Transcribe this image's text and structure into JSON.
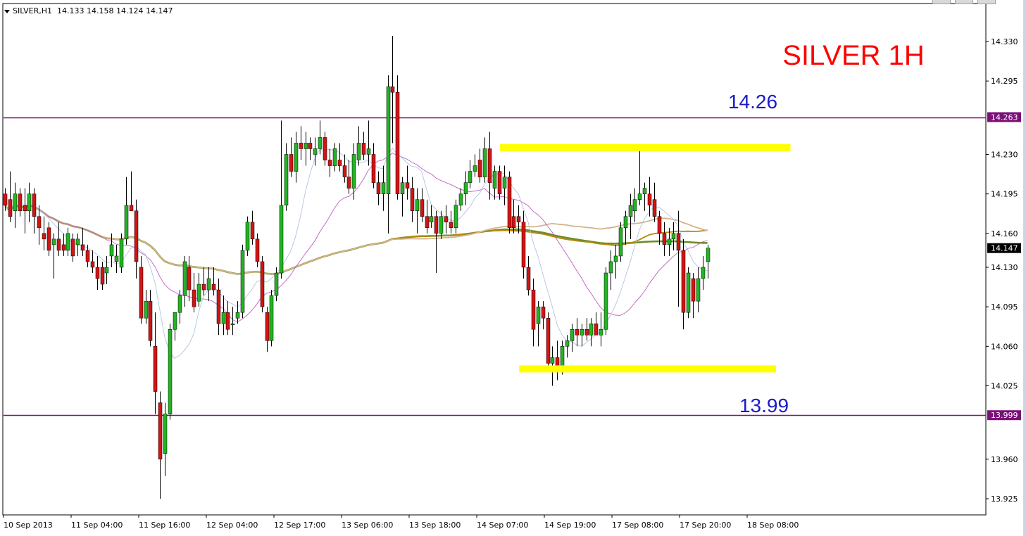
{
  "header": {
    "symbol": "SILVER,H1",
    "ohlc": "14.133 14.158 14.124 14.147"
  },
  "annotations": {
    "title": "SILVER 1H",
    "resistance_label": "14.26",
    "support_label": "13.99"
  },
  "price_axis": {
    "ticks": [
      "14.330",
      "14.295",
      "14.230",
      "14.195",
      "14.160",
      "14.130",
      "14.095",
      "14.060",
      "14.025",
      "13.960",
      "13.925"
    ],
    "hidden_ticks": [
      "14.263",
      "13.999"
    ],
    "badges": [
      {
        "value": "14.263",
        "color": "#7a0f78"
      },
      {
        "value": "14.147",
        "color": "#000000"
      },
      {
        "value": "13.999",
        "color": "#7a0f78"
      }
    ]
  },
  "time_axis": {
    "labels": [
      "10 Sep 2013",
      "11 Sep 04:00",
      "11 Sep 16:00",
      "12 Sep 04:00",
      "12 Sep 17:00",
      "13 Sep 06:00",
      "13 Sep 18:00",
      "14 Sep 07:00",
      "14 Sep 19:00",
      "17 Sep 08:00",
      "17 Sep 20:00",
      "18 Sep 08:00"
    ]
  },
  "colors": {
    "background": "#ffffff",
    "bull": "#22b422",
    "bear": "#d21414",
    "wick": "#000000",
    "hline": "#7a0f78",
    "zone": "#ffff00",
    "title": "#ff0000",
    "level_label": "#1a1acc",
    "ma_long": "#6b8e23",
    "ma_mid": "#b8860b",
    "ma_mid2": "#d2b48c",
    "ma_short": "#b0c4de",
    "ma_fast": "#c060c0"
  },
  "chart_data": {
    "type": "candlestick",
    "title": "SILVER 1H",
    "ylim": [
      13.905,
      14.345
    ],
    "horizontal_lines": [
      14.263,
      13.999
    ],
    "zones": [
      {
        "price": 14.236,
        "from": 102,
        "to": 162
      },
      {
        "price": 14.04,
        "from": 106,
        "to": 159
      }
    ],
    "candles": [
      [
        14.195,
        14.2,
        14.18,
        14.185
      ],
      [
        14.19,
        14.215,
        14.17,
        14.175
      ],
      [
        14.18,
        14.205,
        14.165,
        14.195
      ],
      [
        14.195,
        14.2,
        14.175,
        14.18
      ],
      [
        14.185,
        14.2,
        14.16,
        14.18
      ],
      [
        14.18,
        14.205,
        14.17,
        14.195
      ],
      [
        14.195,
        14.2,
        14.16,
        14.175
      ],
      [
        14.175,
        14.185,
        14.15,
        14.165
      ],
      [
        14.16,
        14.175,
        14.145,
        14.155
      ],
      [
        14.165,
        14.17,
        14.14,
        14.145
      ],
      [
        14.15,
        14.16,
        14.12,
        14.155
      ],
      [
        14.155,
        14.17,
        14.14,
        14.145
      ],
      [
        14.15,
        14.16,
        14.14,
        14.145
      ],
      [
        14.145,
        14.165,
        14.14,
        14.16
      ],
      [
        14.155,
        14.16,
        14.135,
        14.14
      ],
      [
        14.15,
        14.16,
        14.14,
        14.155
      ],
      [
        14.15,
        14.165,
        14.14,
        14.145
      ],
      [
        14.145,
        14.15,
        14.13,
        14.135
      ],
      [
        14.135,
        14.145,
        14.125,
        14.13
      ],
      [
        14.13,
        14.14,
        14.11,
        14.12
      ],
      [
        14.13,
        14.135,
        14.11,
        14.115
      ],
      [
        14.125,
        14.14,
        14.115,
        14.13
      ],
      [
        14.14,
        14.16,
        14.13,
        14.15
      ],
      [
        14.135,
        14.15,
        14.125,
        14.14
      ],
      [
        14.13,
        14.16,
        14.125,
        14.155
      ],
      [
        14.155,
        14.21,
        14.15,
        14.185
      ],
      [
        14.185,
        14.215,
        14.18,
        14.18
      ],
      [
        14.18,
        14.19,
        14.12,
        14.135
      ],
      [
        14.13,
        14.14,
        14.08,
        14.085
      ],
      [
        14.085,
        14.11,
        14.08,
        14.1
      ],
      [
        14.1,
        14.11,
        14.06,
        14.065
      ],
      [
        14.06,
        14.09,
        14.0,
        14.02
      ],
      [
        14.01,
        14.02,
        13.925,
        13.96
      ],
      [
        13.965,
        14.01,
        13.945,
        14.0
      ],
      [
        14.0,
        14.08,
        13.995,
        14.075
      ],
      [
        14.075,
        14.09,
        14.065,
        14.09
      ],
      [
        14.09,
        14.11,
        14.08,
        14.105
      ],
      [
        14.105,
        14.14,
        14.095,
        14.135
      ],
      [
        14.13,
        14.14,
        14.1,
        14.11
      ],
      [
        14.11,
        14.125,
        14.09,
        14.095
      ],
      [
        14.1,
        14.125,
        14.095,
        14.115
      ],
      [
        14.115,
        14.13,
        14.105,
        14.11
      ],
      [
        14.11,
        14.13,
        14.1,
        14.12
      ],
      [
        14.115,
        14.13,
        14.105,
        14.11
      ],
      [
        14.11,
        14.12,
        14.07,
        14.08
      ],
      [
        14.08,
        14.105,
        14.07,
        14.09
      ],
      [
        14.09,
        14.1,
        14.07,
        14.075
      ],
      [
        14.08,
        14.095,
        14.07,
        14.08
      ],
      [
        14.085,
        14.1,
        14.08,
        14.09
      ],
      [
        14.09,
        14.15,
        14.085,
        14.145
      ],
      [
        14.145,
        14.175,
        14.14,
        14.17
      ],
      [
        14.17,
        14.18,
        14.15,
        14.155
      ],
      [
        14.155,
        14.16,
        14.13,
        14.135
      ],
      [
        14.135,
        14.14,
        14.09,
        14.095
      ],
      [
        14.09,
        14.095,
        14.055,
        14.065
      ],
      [
        14.065,
        14.11,
        14.06,
        14.105
      ],
      [
        14.105,
        14.13,
        14.1,
        14.125
      ],
      [
        14.125,
        14.26,
        14.12,
        14.185
      ],
      [
        14.185,
        14.24,
        14.18,
        14.23
      ],
      [
        14.23,
        14.245,
        14.21,
        14.215
      ],
      [
        14.215,
        14.25,
        14.205,
        14.24
      ],
      [
        14.24,
        14.255,
        14.225,
        14.235
      ],
      [
        14.235,
        14.25,
        14.22,
        14.24
      ],
      [
        14.24,
        14.245,
        14.225,
        14.235
      ],
      [
        14.23,
        14.245,
        14.22,
        14.235
      ],
      [
        14.235,
        14.26,
        14.23,
        14.245
      ],
      [
        14.245,
        14.25,
        14.22,
        14.225
      ],
      [
        14.225,
        14.235,
        14.21,
        14.22
      ],
      [
        14.22,
        14.24,
        14.215,
        14.235
      ],
      [
        14.225,
        14.24,
        14.215,
        14.22
      ],
      [
        14.22,
        14.23,
        14.205,
        14.21
      ],
      [
        14.21,
        14.225,
        14.195,
        14.2
      ],
      [
        14.2,
        14.24,
        14.19,
        14.23
      ],
      [
        14.225,
        14.255,
        14.22,
        14.24
      ],
      [
        14.24,
        14.25,
        14.225,
        14.23
      ],
      [
        14.23,
        14.26,
        14.22,
        14.235
      ],
      [
        14.23,
        14.24,
        14.2,
        14.205
      ],
      [
        14.205,
        14.215,
        14.185,
        14.195
      ],
      [
        14.195,
        14.22,
        14.18,
        14.205
      ],
      [
        14.195,
        14.3,
        14.16,
        14.29
      ],
      [
        14.29,
        14.335,
        14.24,
        14.285
      ],
      [
        14.285,
        14.3,
        14.19,
        14.195
      ],
      [
        14.195,
        14.21,
        14.175,
        14.205
      ],
      [
        14.205,
        14.22,
        14.19,
        14.2
      ],
      [
        14.2,
        14.21,
        14.17,
        14.18
      ],
      [
        14.18,
        14.2,
        14.16,
        14.19
      ],
      [
        14.19,
        14.2,
        14.17,
        14.175
      ],
      [
        14.175,
        14.19,
        14.16,
        14.165
      ],
      [
        14.17,
        14.185,
        14.165,
        14.175
      ],
      [
        14.175,
        14.18,
        14.125,
        14.16
      ],
      [
        14.16,
        14.18,
        14.155,
        14.175
      ],
      [
        14.175,
        14.185,
        14.16,
        14.17
      ],
      [
        14.17,
        14.18,
        14.16,
        14.165
      ],
      [
        14.165,
        14.19,
        14.16,
        14.185
      ],
      [
        14.185,
        14.2,
        14.18,
        14.195
      ],
      [
        14.195,
        14.215,
        14.185,
        14.205
      ],
      [
        14.205,
        14.225,
        14.2,
        14.215
      ],
      [
        14.215,
        14.23,
        14.21,
        14.22
      ],
      [
        14.225,
        14.235,
        14.205,
        14.21
      ],
      [
        14.21,
        14.245,
        14.205,
        14.235
      ],
      [
        14.235,
        14.25,
        14.19,
        14.205
      ],
      [
        14.2,
        14.22,
        14.19,
        14.215
      ],
      [
        14.215,
        14.22,
        14.19,
        14.195
      ],
      [
        14.2,
        14.22,
        14.185,
        14.21
      ],
      [
        14.21,
        14.215,
        14.16,
        14.165
      ],
      [
        14.175,
        14.19,
        14.16,
        14.165
      ],
      [
        14.175,
        14.185,
        14.16,
        14.17
      ],
      [
        14.17,
        14.18,
        14.12,
        14.13
      ],
      [
        14.13,
        14.14,
        14.105,
        14.11
      ],
      [
        14.11,
        14.12,
        14.06,
        14.075
      ],
      [
        14.08,
        14.1,
        14.06,
        14.095
      ],
      [
        14.095,
        14.1,
        14.075,
        14.085
      ],
      [
        14.085,
        14.09,
        14.04,
        14.045
      ],
      [
        14.045,
        14.06,
        14.025,
        14.05
      ],
      [
        14.05,
        14.065,
        14.03,
        14.04
      ],
      [
        14.04,
        14.065,
        14.035,
        14.06
      ],
      [
        14.06,
        14.07,
        14.05,
        14.065
      ],
      [
        14.065,
        14.08,
        14.055,
        14.075
      ],
      [
        14.075,
        14.085,
        14.06,
        14.07
      ],
      [
        14.07,
        14.08,
        14.06,
        14.075
      ],
      [
        14.075,
        14.085,
        14.065,
        14.07
      ],
      [
        14.07,
        14.085,
        14.06,
        14.08
      ],
      [
        14.08,
        14.09,
        14.07,
        14.07
      ],
      [
        14.07,
        14.09,
        14.06,
        14.075
      ],
      [
        14.075,
        14.13,
        14.07,
        14.125
      ],
      [
        14.125,
        14.145,
        14.11,
        14.135
      ],
      [
        14.135,
        14.15,
        14.12,
        14.14
      ],
      [
        14.14,
        14.17,
        14.135,
        14.165
      ],
      [
        14.165,
        14.18,
        14.15,
        14.175
      ],
      [
        14.175,
        14.195,
        14.155,
        14.185
      ],
      [
        14.18,
        14.2,
        14.17,
        14.19
      ],
      [
        14.19,
        14.235,
        14.185,
        14.195
      ],
      [
        14.195,
        14.205,
        14.18,
        14.2
      ],
      [
        14.195,
        14.21,
        14.175,
        14.185
      ],
      [
        14.19,
        14.205,
        14.17,
        14.175
      ],
      [
        14.175,
        14.18,
        14.15,
        14.16
      ],
      [
        14.16,
        14.17,
        14.14,
        14.15
      ],
      [
        14.15,
        14.165,
        14.14,
        14.155
      ],
      [
        14.155,
        14.17,
        14.145,
        14.16
      ],
      [
        14.16,
        14.18,
        14.095,
        14.145
      ],
      [
        14.145,
        14.155,
        14.075,
        14.09
      ],
      [
        14.09,
        14.13,
        14.085,
        14.125
      ],
      [
        14.12,
        14.125,
        14.085,
        14.1
      ],
      [
        14.1,
        14.13,
        14.09,
        14.12
      ],
      [
        14.12,
        14.14,
        14.11,
        14.13
      ],
      [
        14.135,
        14.15,
        14.12,
        14.147
      ]
    ]
  }
}
